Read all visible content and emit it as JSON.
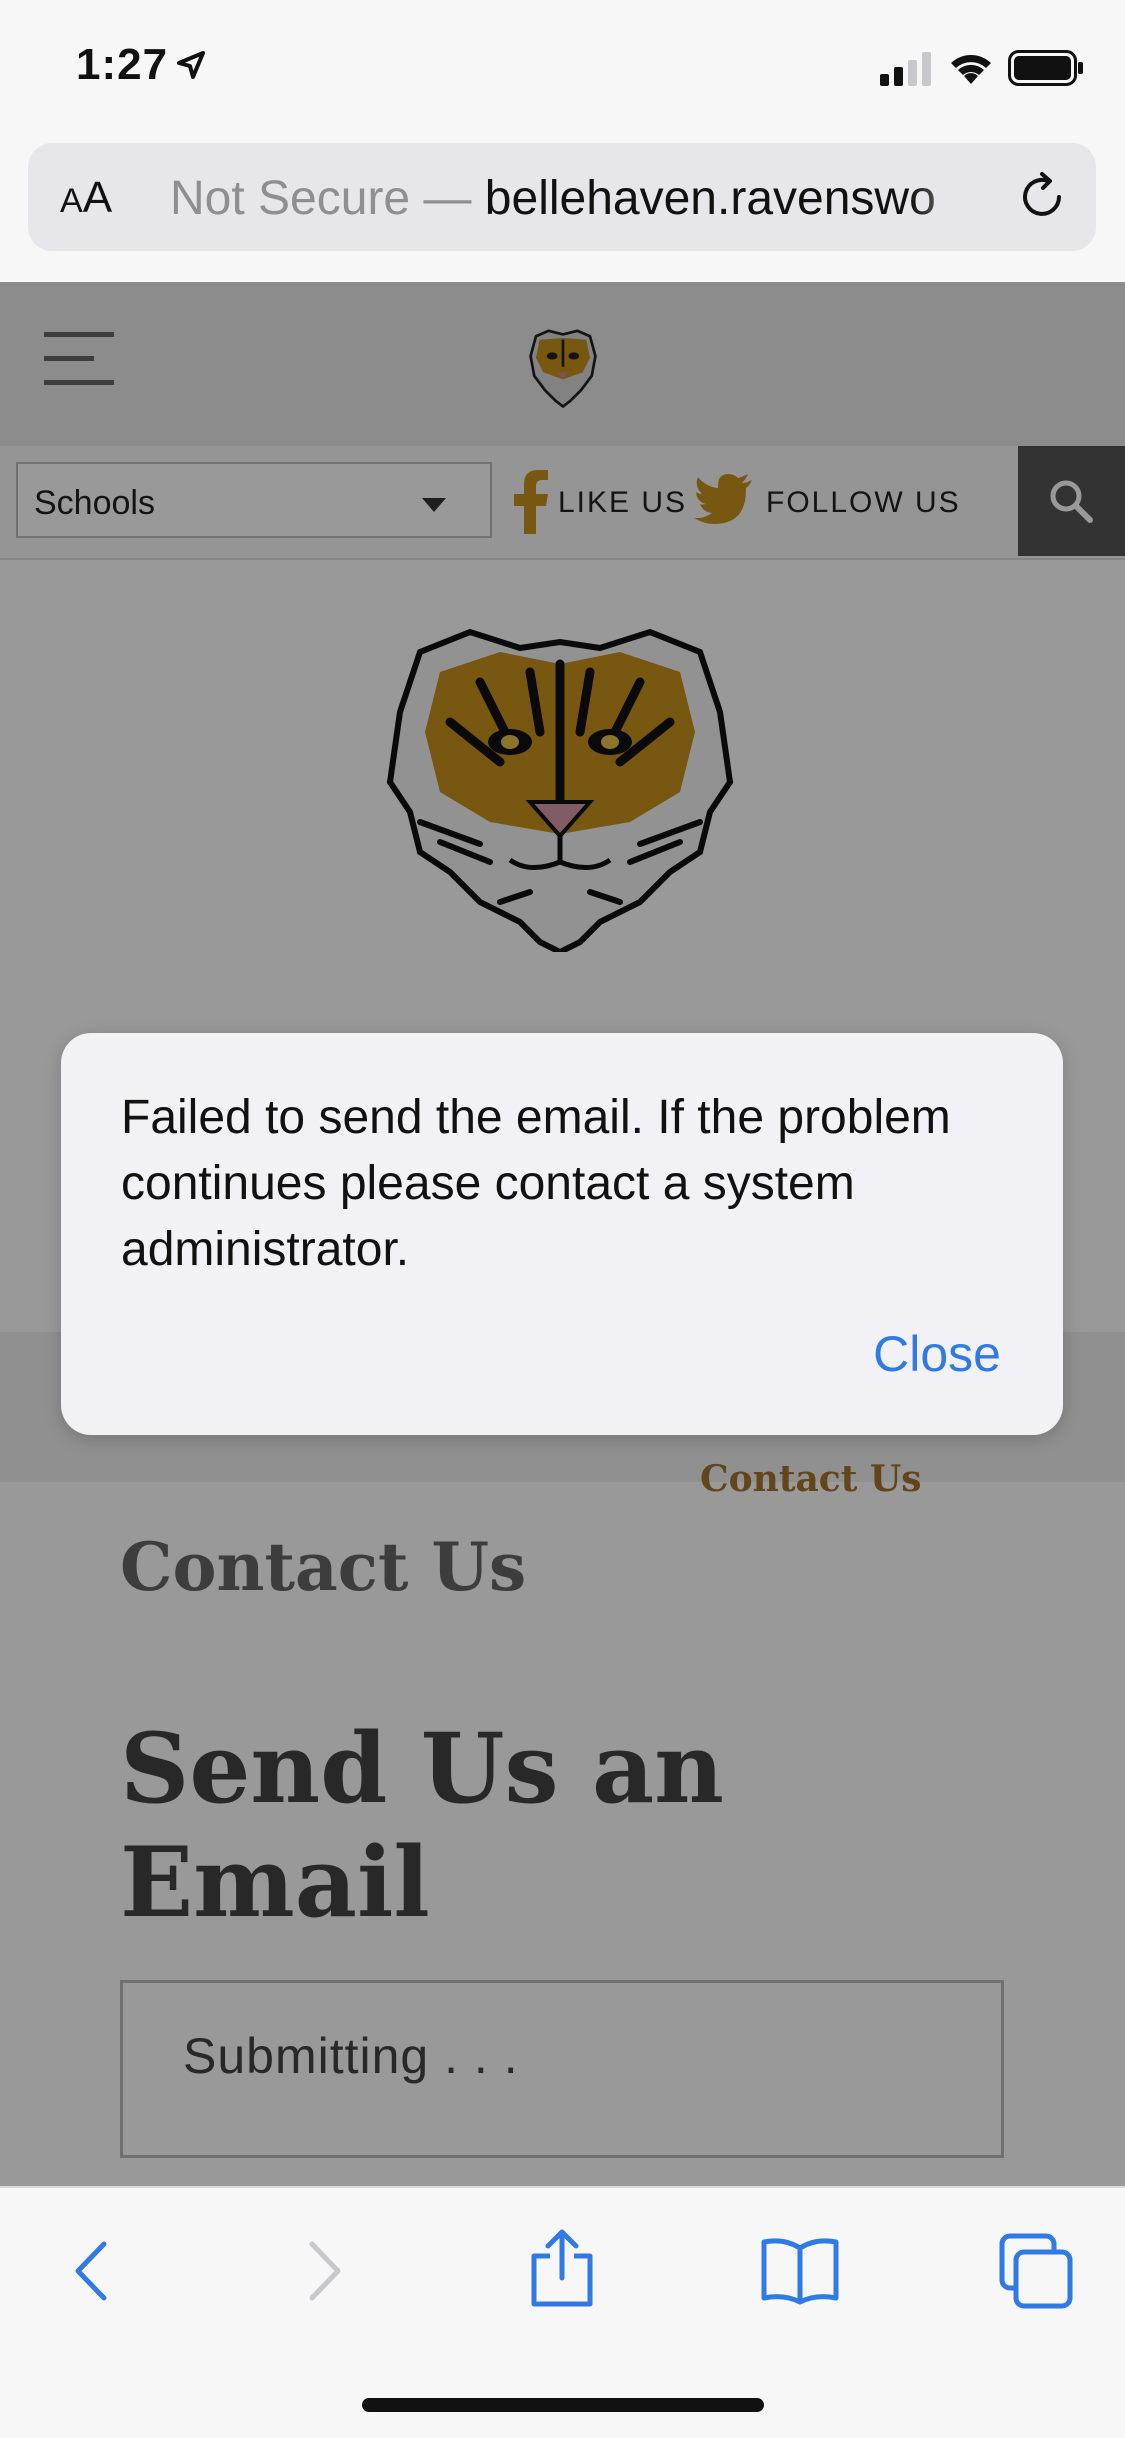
{
  "status_bar": {
    "time": "1:27"
  },
  "url_bar": {
    "aa_small": "A",
    "aa_large": "A",
    "security_prefix": "Not Secure — ",
    "host": "bellehaven.ravenswo"
  },
  "site": {
    "schools_select": {
      "selected": "Schools"
    },
    "like_label": "LIKE US",
    "follow_label": "FOLLOW US",
    "breadcrumb_current": "Contact Us",
    "section_heading": "Contact Us",
    "page_heading": "Send Us an Email",
    "submit_status": "Submitting . . ."
  },
  "alert": {
    "message": "Failed to send the email.  If the problem continues please contact a system administrator.",
    "close_label": "Close"
  },
  "colors": {
    "accent_blue": "#2f7ae5",
    "tiger_orange": "#c8921c",
    "breadcrumb_brown": "#a5722d"
  },
  "icons": {
    "status": [
      "location-arrow-icon",
      "cellular-signal-icon",
      "wifi-icon",
      "battery-icon"
    ],
    "site": [
      "hamburger-menu-icon",
      "tiger-logo",
      "facebook-icon",
      "twitter-icon",
      "search-icon"
    ],
    "toolbar": [
      "back-icon",
      "forward-icon",
      "share-icon",
      "bookmarks-icon",
      "tabs-icon"
    ]
  }
}
